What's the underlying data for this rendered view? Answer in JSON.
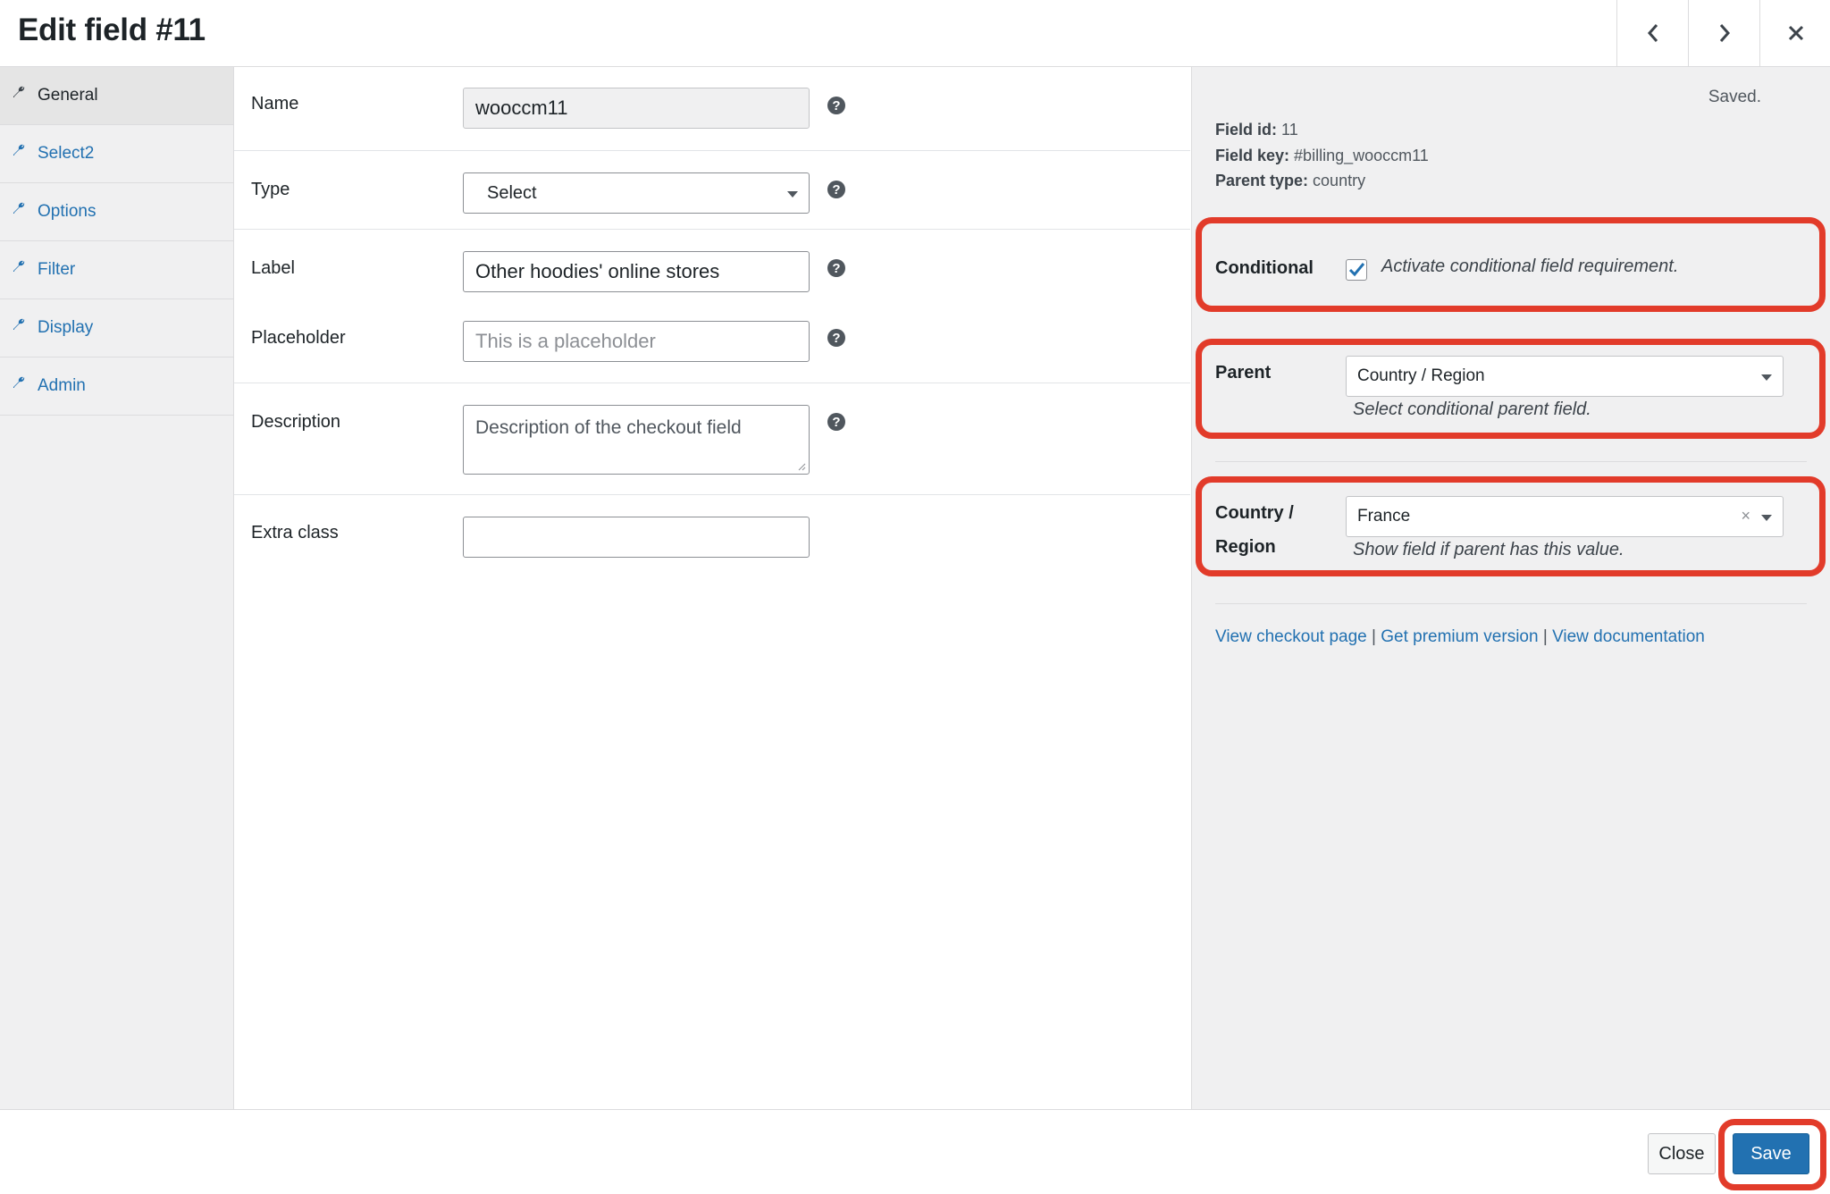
{
  "header": {
    "title": "Edit field #11"
  },
  "sidebar": {
    "items": [
      {
        "label": "General",
        "active": true
      },
      {
        "label": "Select2"
      },
      {
        "label": "Options"
      },
      {
        "label": "Filter"
      },
      {
        "label": "Display"
      },
      {
        "label": "Admin"
      }
    ]
  },
  "form": {
    "name": {
      "label": "Name",
      "value": "wooccm11"
    },
    "type": {
      "label": "Type",
      "value": "Select"
    },
    "label": {
      "label": "Label",
      "value": "Other hoodies' online stores"
    },
    "placeholder": {
      "label": "Placeholder",
      "placeholder": "This is a placeholder"
    },
    "description": {
      "label": "Description",
      "placeholder": "Description of the checkout field"
    },
    "extra_class": {
      "label": "Extra class",
      "value": ""
    }
  },
  "panel": {
    "status": "Saved.",
    "field_id_label": "Field id:",
    "field_id_value": "11",
    "field_key_label": "Field key:",
    "field_key_value": "#billing_wooccm11",
    "parent_type_label": "Parent type:",
    "parent_type_value": "country",
    "conditional": {
      "label": "Conditional",
      "checked": true,
      "description": "Activate conditional field requirement."
    },
    "parent": {
      "label": "Parent",
      "value": "Country / Region",
      "description": "Select conditional parent field."
    },
    "country": {
      "label_line1": "Country /",
      "label_line2": "Region",
      "value": "France",
      "clear": "×",
      "description": "Show field if parent has this value."
    },
    "links": {
      "checkout": "View checkout page",
      "premium": "Get premium version",
      "docs": "View documentation",
      "separator": "|"
    }
  },
  "footer": {
    "close_label": "Close",
    "save_label": "Save"
  },
  "colors": {
    "accent": "#2271b1",
    "highlight": "#e23b2a",
    "panel_bg": "#f0f0f1"
  },
  "icons": [
    "chevron-left-icon",
    "chevron-right-icon",
    "close-icon",
    "wrench-icon",
    "help-icon",
    "checkmark-icon",
    "dropdown-caret-icon"
  ]
}
